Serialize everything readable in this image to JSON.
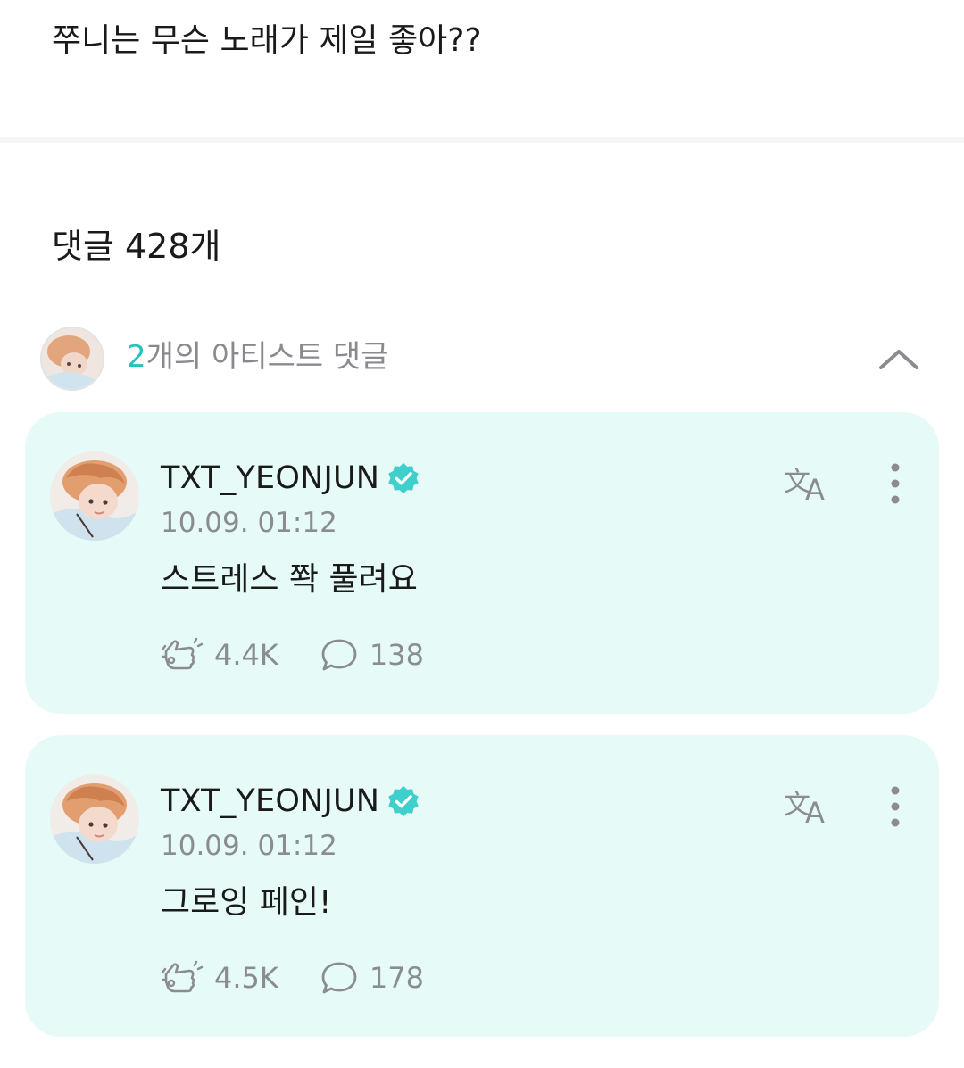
{
  "post": {
    "text": "쭈니는 무슨 노래가 제일 좋아??"
  },
  "comments_header": {
    "label": "댓글 428개"
  },
  "artist_summary": {
    "count": "2",
    "label": "개의 아티스트 댓글",
    "collapse_icon": "chevron-up-icon"
  },
  "artist_comments": [
    {
      "username": "TXT_YEONJUN",
      "timestamp": "10.09. 01:12",
      "body": "스트레스 쫙 풀려요",
      "likes": "4.4K",
      "replies": "138"
    },
    {
      "username": "TXT_YEONJUN",
      "timestamp": "10.09. 01:12",
      "body": "그로잉 페인!",
      "likes": "4.5K",
      "replies": "178"
    }
  ],
  "colors": {
    "accent": "#27c2be",
    "card_background": "#e6fbf7",
    "verified_badge": "#3fd0cb",
    "muted_text": "#8a8c90"
  },
  "icons": {
    "verified": "verified-badge-icon",
    "translate": "translate-icon",
    "more": "more-vertical-icon",
    "like": "cheer-like-icon",
    "reply": "speech-bubble-icon"
  }
}
